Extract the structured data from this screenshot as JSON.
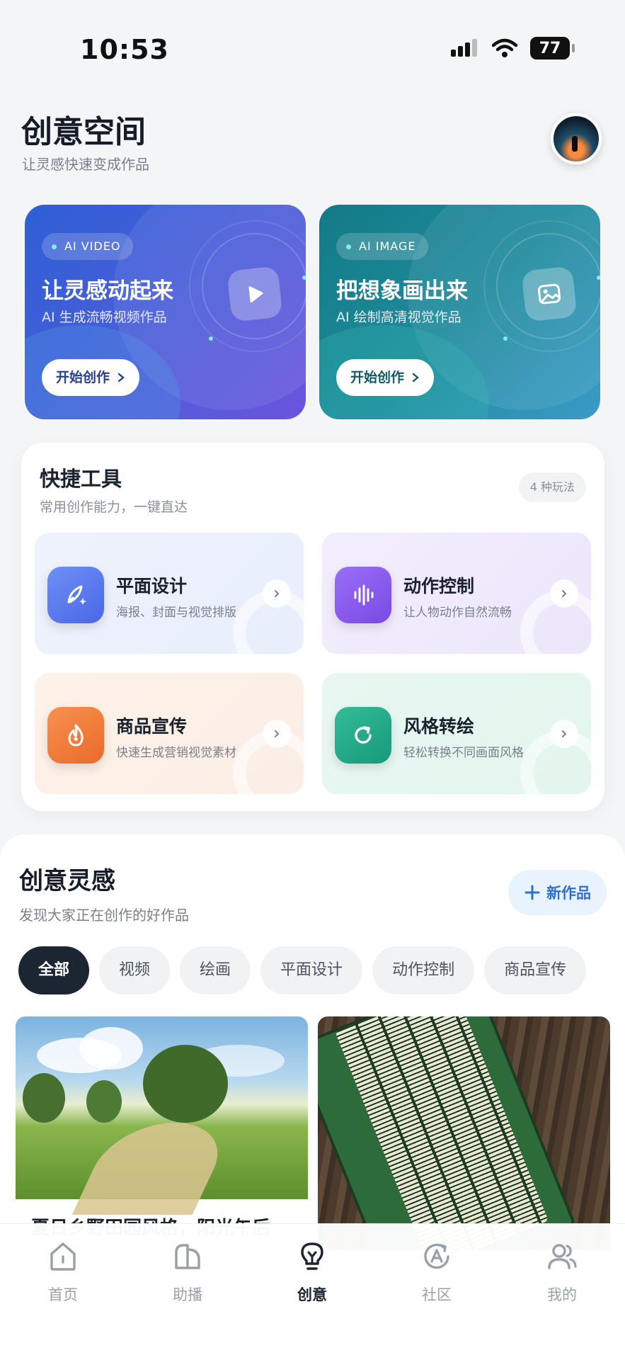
{
  "status": {
    "time": "10:53",
    "battery": "77"
  },
  "header": {
    "title": "创意空间",
    "subtitle": "让灵感快速变成作品"
  },
  "hero": [
    {
      "tag": "AI VIDEO",
      "title": "让灵感动起来",
      "subtitle": "AI 生成流畅视频作品",
      "cta": "开始创作",
      "icon": "play-icon"
    },
    {
      "tag": "AI IMAGE",
      "title": "把想象画出来",
      "subtitle": "AI 绘制高清视觉作品",
      "cta": "开始创作",
      "icon": "image-icon"
    }
  ],
  "tools": {
    "title": "快捷工具",
    "subtitle": "常用创作能力，一键直达",
    "badge": "4 种玩法",
    "items": [
      {
        "name": "平面设计",
        "desc": "海报、封面与视觉排版",
        "icon": "pen-sparkle-icon",
        "color": "#5a7cf0"
      },
      {
        "name": "动作控制",
        "desc": "让人物动作自然流畅",
        "icon": "waveform-icon",
        "color": "#8a5cf0"
      },
      {
        "name": "商品宣传",
        "desc": "快速生成营销视觉素材",
        "icon": "flame-icon",
        "color": "#f07a3a"
      },
      {
        "name": "风格转绘",
        "desc": "轻松转换不同画面风格",
        "icon": "refresh-icon",
        "color": "#22a884"
      }
    ]
  },
  "inspiration": {
    "title": "创意灵感",
    "subtitle": "发现大家正在创作的好作品",
    "new_button": "新作品",
    "chips": [
      "全部",
      "视频",
      "绘画",
      "平面设计",
      "动作控制",
      "商品宣传"
    ],
    "cards": [
      {
        "caption": "夏日乡野田园风格，阳光午后"
      },
      {
        "caption": ""
      }
    ]
  },
  "tabbar": [
    "首页",
    "助播",
    "创意",
    "社区",
    "我的"
  ]
}
